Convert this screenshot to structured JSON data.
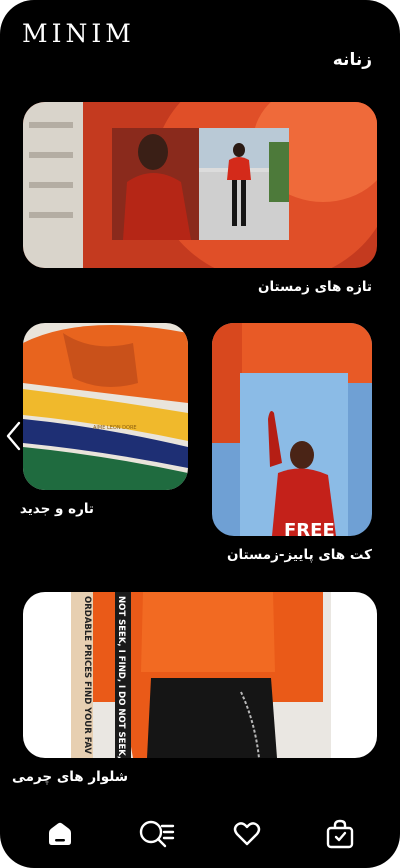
{
  "brand": {
    "logo": "MINIM"
  },
  "section": {
    "title": "زنانه"
  },
  "cards": [
    {
      "caption": "تازه های زمستان"
    },
    {
      "caption": "کت های پاییز-زمستان",
      "poster_text": "FREE"
    },
    {
      "caption": "تاره و جدید",
      "product_text": "AIME LEON DORE"
    },
    {
      "caption": "شلوار های چرمی",
      "strip_left": "ORDABLE PRICES FIND YOUR FAV",
      "strip_right": "NOT SEEK, I FIND, I DO NOT SEEK, I"
    }
  ],
  "nav": {
    "items": [
      {
        "icon": "home-icon",
        "active": true
      },
      {
        "icon": "search-filter-icon",
        "active": false
      },
      {
        "icon": "heart-icon",
        "active": false
      },
      {
        "icon": "shopping-bag-icon",
        "active": false
      }
    ]
  },
  "colors": {
    "background": "#000000",
    "accent": "#e8411d",
    "text": "#ffffff"
  }
}
